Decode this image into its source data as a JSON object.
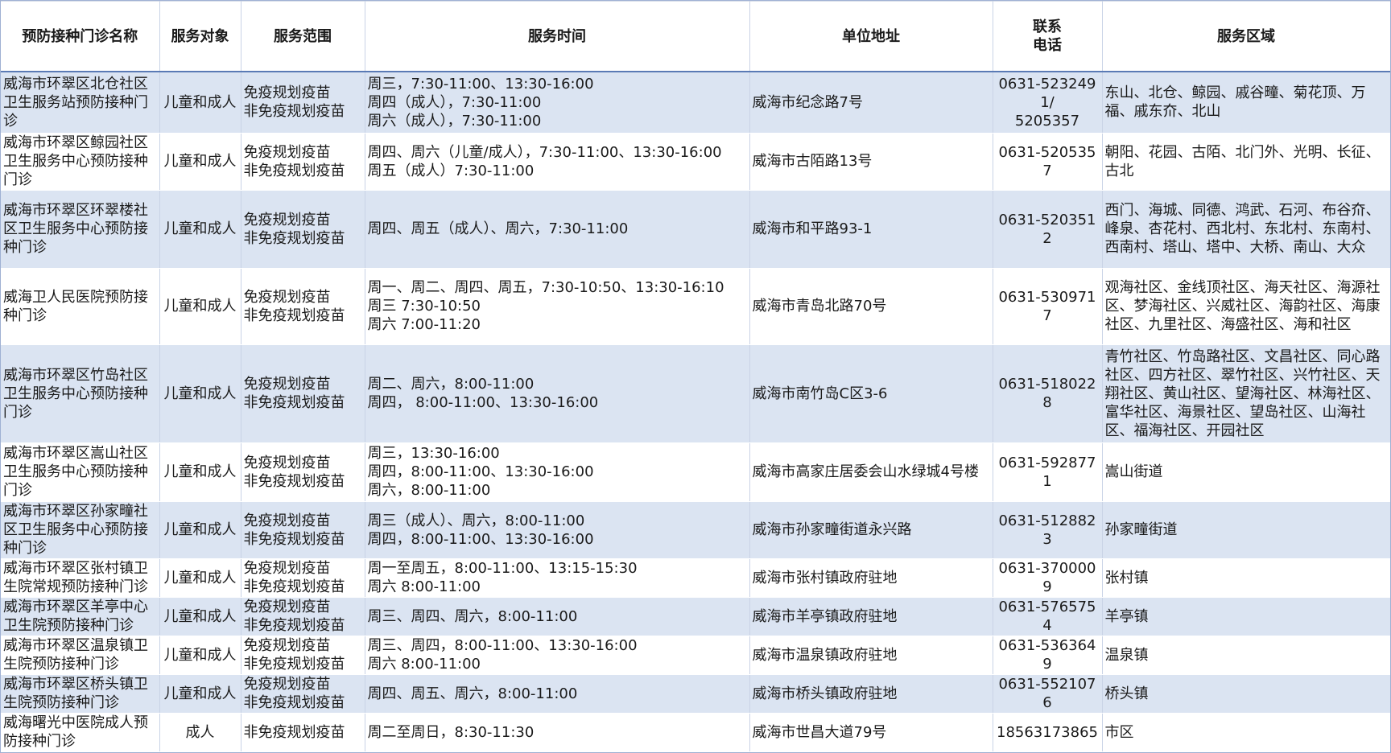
{
  "header": {
    "name": "预防接种门诊名称",
    "target": "服务对象",
    "scope": "服务范围",
    "time": "服务时间",
    "address": "单位地址",
    "phone": "联系\n电话",
    "area": "服务区域"
  },
  "rows": [
    {
      "name": "威海市环翠区北仓社区卫生服务站预防接种门诊",
      "target": "儿童和成人",
      "scope": "免疫规划疫苗\n非免疫规划疫苗",
      "time": "周三，7:30-11:00、13:30-16:00\n周四（成人），7:30-11:00\n周六（成人），7:30-11:00",
      "address": "威海市纪念路7号",
      "phone": "0631-5232491/\n5205357",
      "area": "东山、北仓、鲸园、戚谷疃、菊花顶、万福、戚东夼、北山"
    },
    {
      "name": "威海市环翠区鲸园社区卫生服务中心预防接种门诊",
      "target": "儿童和成人",
      "scope": "免疫规划疫苗\n非免疫规划疫苗",
      "time": "周四、周六（儿童/成人），7:30-11:00、13:30-16:00\n周五（成人）7:30-11:00",
      "address": "威海市古陌路13号",
      "phone": "0631-5205357",
      "area": "朝阳、花园、古陌、北门外、光明、长征、古北"
    },
    {
      "name": "威海市环翠区环翠楼社区卫生服务中心预防接种门诊",
      "target": "儿童和成人",
      "scope": "免疫规划疫苗\n非免疫规划疫苗",
      "time": "周四、周五（成人）、周六，7:30-11:00",
      "address": "威海市和平路93-1",
      "phone": "0631-5203512",
      "area": "西门、海城、同德、鸿武、石河、布谷夼、峰泉、杏花村、西北村、东北村、东南村、西南村、塔山、塔中、大桥、南山、大众"
    },
    {
      "name": "威海卫人民医院预防接种门诊",
      "target": "儿童和成人",
      "scope": "免疫规划疫苗\n非免疫规划疫苗",
      "time": "周一、周二、周四、周五，7:30-10:50、13:30-16:10\n周三 7:30-10:50\n周六 7:00-11:20",
      "address": "威海市青岛北路70号",
      "phone": "0631-5309717",
      "area": "观海社区、金线顶社区、海天社区、海源社区、梦海社区、兴威社区、海韵社区、海康社区、九里社区、海盛社区、海和社区"
    },
    {
      "name": "威海市环翠区竹岛社区卫生服务中心预防接种门诊",
      "target": "儿童和成人",
      "scope": "免疫规划疫苗\n非免疫规划疫苗",
      "time": "周二、周六，8:00-11:00\n周四， 8:00-11:00、13:30-16:00",
      "address": "威海市南竹岛C区3-6",
      "phone": "0631-5180228",
      "area": "青竹社区、竹岛路社区、文昌社区、同心路社区、四方社区、翠竹社区、兴竹社区、天翔社区、黄山社区、望海社区、林海社区、富华社区、海景社区、望岛社区、山海社区、福海社区、开园社区"
    },
    {
      "name": "威海市环翠区嵩山社区卫生服务中心预防接种门诊",
      "target": "儿童和成人",
      "scope": "免疫规划疫苗\n非免疫规划疫苗",
      "time": "周三，13:30-16:00\n周四，8:00-11:00、13:30-16:00\n周六，8:00-11:00",
      "address": "威海市高家庄居委会山水绿城4号楼",
      "phone": "0631-5928771",
      "area": "嵩山街道"
    },
    {
      "name": "威海市环翠区孙家疃社区卫生服务中心预防接种门诊",
      "target": "儿童和成人",
      "scope": "免疫规划疫苗\n非免疫规划疫苗",
      "time": "周三（成人）、周六，8:00-11:00\n周四，8:00-11:00、13:30-16:00",
      "address": "威海市孙家疃街道永兴路",
      "phone": "0631-5128823",
      "area": "孙家疃街道"
    },
    {
      "name": "威海市环翠区张村镇卫生院常规预防接种门诊",
      "target": "儿童和成人",
      "scope": "免疫规划疫苗\n非免疫规划疫苗",
      "time": "周一至周五，8:00-11:00、13:15-15:30\n周六 8:00-11:00",
      "address": "威海市张村镇政府驻地",
      "phone": "0631-3700009",
      "area": "张村镇"
    },
    {
      "name": "威海市环翠区羊亭中心卫生院预防接种门诊",
      "target": "儿童和成人",
      "scope": "免疫规划疫苗\n非免疫规划疫苗",
      "time": "周三、周四、周六，8:00-11:00",
      "address": "威海市羊亭镇政府驻地",
      "phone": "0631-5765754",
      "area": "羊亭镇"
    },
    {
      "name": "威海市环翠区温泉镇卫生院预防接种门诊",
      "target": "儿童和成人",
      "scope": "免疫规划疫苗\n非免疫规划疫苗",
      "time": "周三、周四，8:00-11:00、13:30-16:00\n周六 8:00-11:00",
      "address": "威海市温泉镇政府驻地",
      "phone": "0631-5363649",
      "area": "温泉镇"
    },
    {
      "name": "威海市环翠区桥头镇卫生院预防接种门诊",
      "target": "儿童和成人",
      "scope": "免疫规划疫苗\n非免疫规划疫苗",
      "time": "周四、周五、周六，8:00-11:00",
      "address": "威海市桥头镇政府驻地",
      "phone": "0631-5521076",
      "area": "桥头镇"
    },
    {
      "name": "威海曙光中医院成人预防接种门诊",
      "target": "成人",
      "scope": "非免疫规划疫苗",
      "time": "周二至周日，8:30-11:30",
      "address": "威海市世昌大道79号",
      "phone": "18563173865",
      "area": "市区"
    }
  ]
}
